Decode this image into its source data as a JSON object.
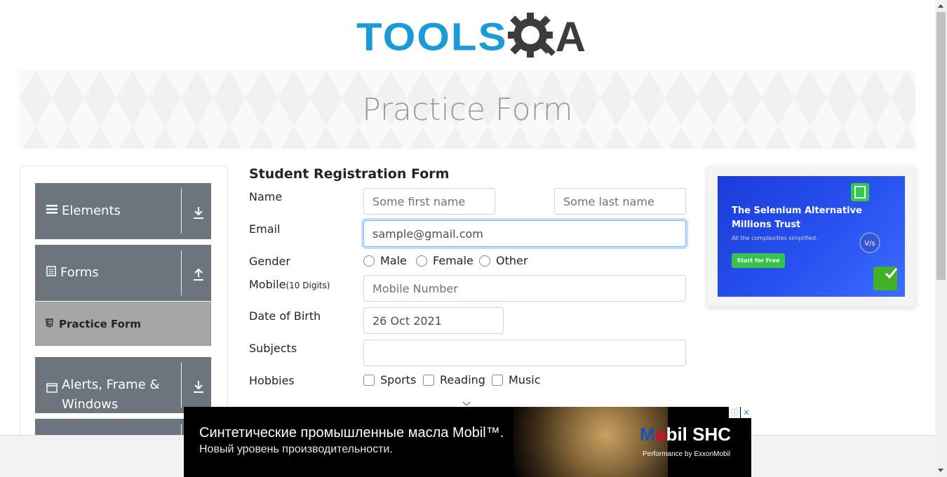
{
  "logo": {
    "tools": "TOOLS",
    "qa_a": "A"
  },
  "banner": {
    "title": "Practice Form"
  },
  "sidebar": {
    "groups": [
      {
        "label": "Elements",
        "icon": "hamburger-icon",
        "arrow": "download-arrow-icon"
      },
      {
        "label": "Forms",
        "icon": "document-icon",
        "arrow": "upload-arrow-icon"
      },
      {
        "label": "Alerts, Frame & Windows",
        "icon": "window-icon",
        "arrow": "download-arrow-icon"
      }
    ],
    "forms_items": [
      {
        "label": "Practice Form"
      }
    ]
  },
  "form": {
    "title": "Student Registration Form",
    "name_label": "Name",
    "first_name_placeholder": "Some first name",
    "last_name_placeholder": "Some last name",
    "email_label": "Email",
    "email_value": "sample@gmail.com",
    "gender_label": "Gender",
    "gender_options": [
      "Male",
      "Female",
      "Other"
    ],
    "mobile_label": "Mobile",
    "mobile_hint": "(10 Digits)",
    "mobile_placeholder": "Mobile Number",
    "dob_label": "Date of Birth",
    "dob_value": "26 Oct 2021",
    "subjects_label": "Subjects",
    "hobbies_label": "Hobbies",
    "hobbies_options": [
      "Sports",
      "Reading",
      "Music"
    ]
  },
  "ad_right": {
    "headline": "The Selenium Alternative Millions Trust",
    "sub": "All the complexities simplified.",
    "cta": "Start for Free"
  },
  "ad_bottom": {
    "line1": "Синтетические промышленные масла Mobil™.",
    "line2": "Новый уровень производительности.",
    "brand_m": "M",
    "brand_o": "o",
    "brand_rest": "bil SHC",
    "perf": "Performance by ExxonMobil",
    "info_icon": "ⓘ",
    "close_icon": "✕"
  },
  "colors": {
    "tools_blue": "#1a9bd7",
    "sidebar_gray": "#6c757d",
    "active_item": "#a6a6a6"
  }
}
